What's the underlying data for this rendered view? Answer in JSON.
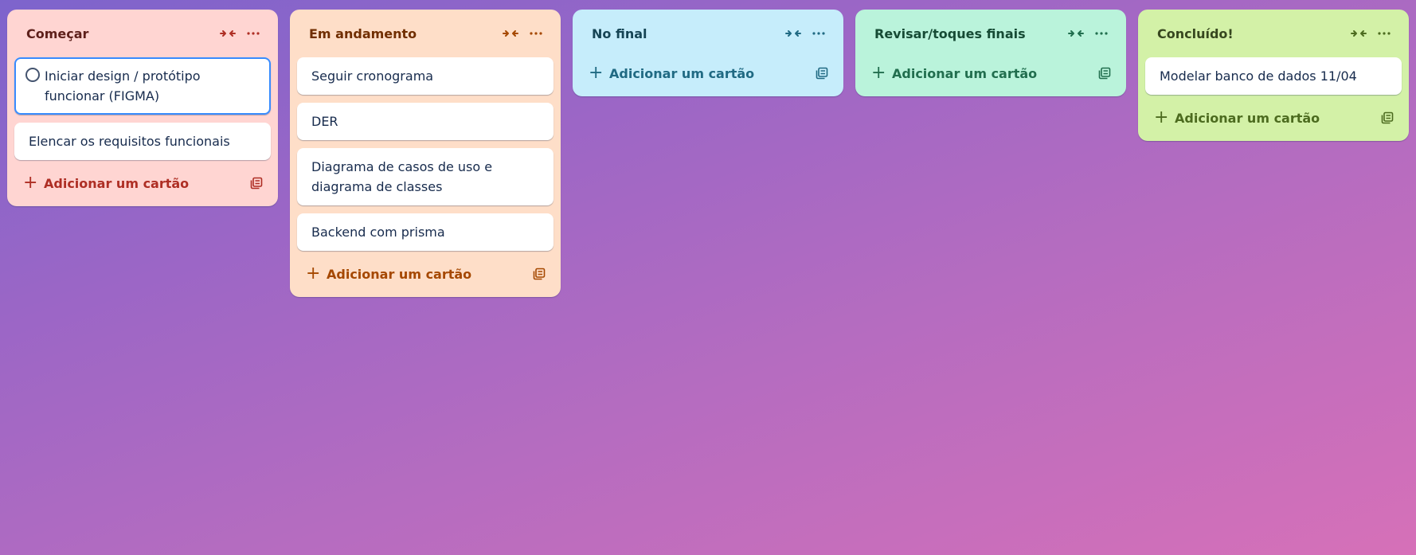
{
  "lists": [
    {
      "title": "Começar",
      "cards": [
        "Iniciar design / protótipo funcionar (FIGMA)",
        "Elencar os requisitos funcionais"
      ],
      "add_label": "Adicionar um cartão"
    },
    {
      "title": "Em andamento",
      "cards": [
        "Seguir cronograma",
        "DER",
        "Diagrama de casos de uso e diagrama de classes",
        "Backend com prisma"
      ],
      "add_label": "Adicionar um cartão"
    },
    {
      "title": "No final",
      "cards": [],
      "add_label": "Adicionar um cartão"
    },
    {
      "title": "Revisar/toques finais",
      "cards": [],
      "add_label": "Adicionar um cartão"
    },
    {
      "title": "Concluído!",
      "cards": [
        "Modelar banco de dados 11/04"
      ],
      "add_label": "Adicionar um cartão"
    }
  ],
  "icons": {
    "collapse": "collapse-icon",
    "more": "more-icon",
    "plus": "plus-icon",
    "template": "template-icon"
  },
  "plus_glyph": "+",
  "colors": {
    "accent_focus": "#388bff",
    "list_red": "#ffd5d2",
    "list_orange": "#fedec8",
    "list_blue": "#c6edfb",
    "list_green": "#baf3db",
    "list_lime": "#d3f1a7"
  }
}
